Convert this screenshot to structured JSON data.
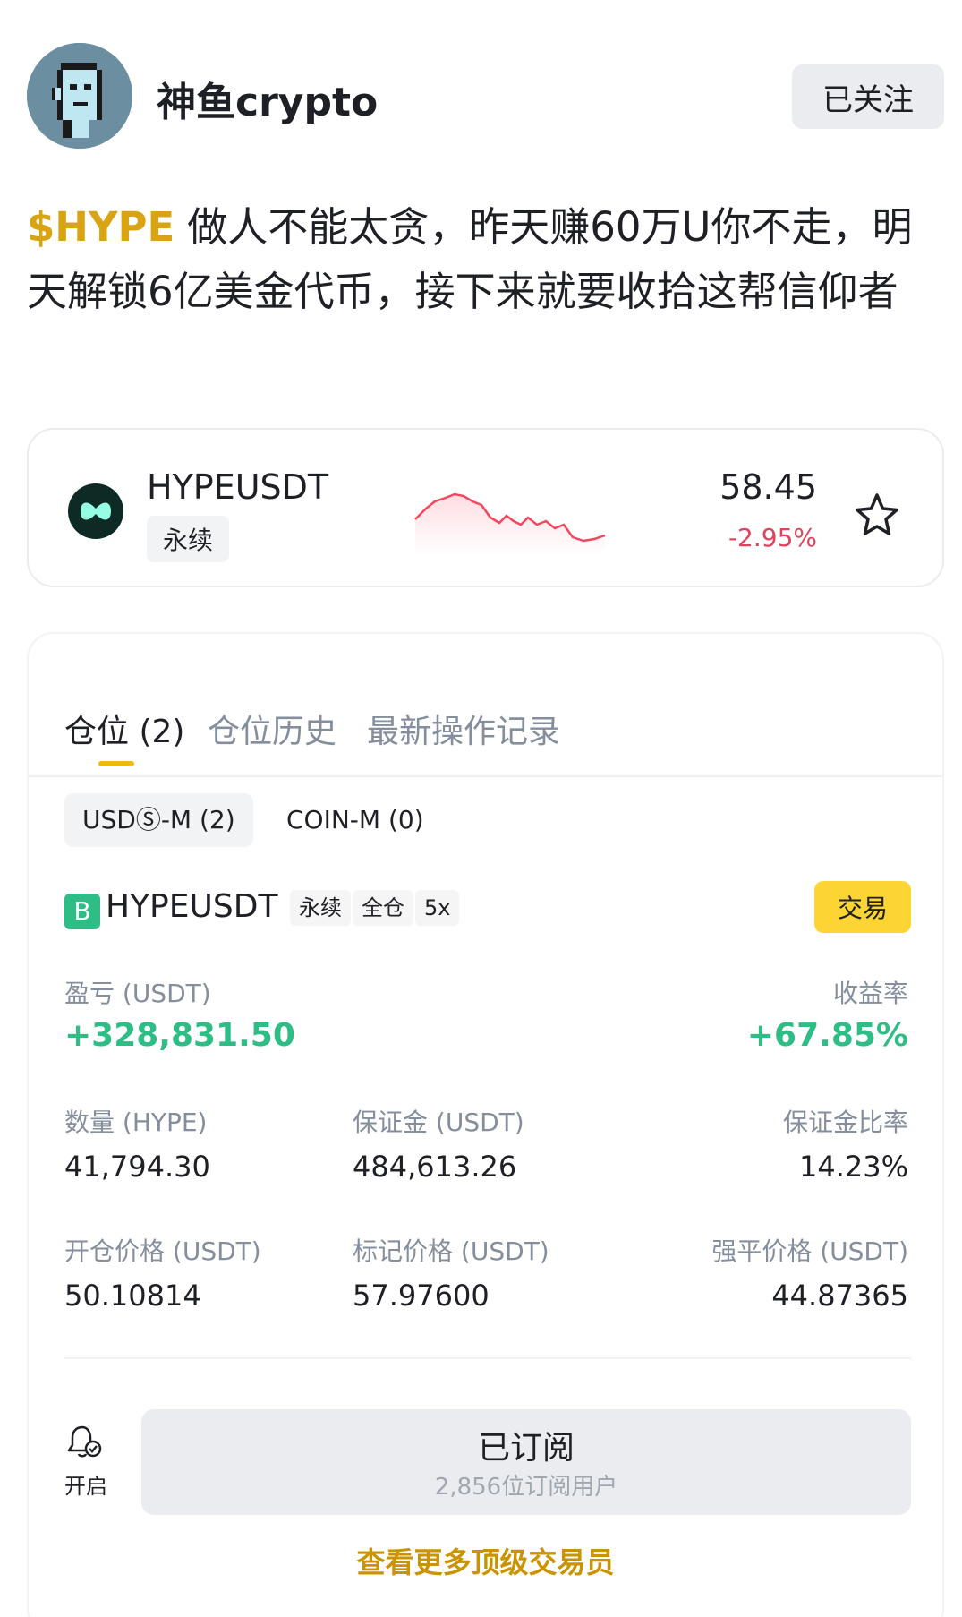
{
  "header": {
    "author_name": "神鱼crypto",
    "follow_label": "已关注"
  },
  "post": {
    "ticker": "$HYPE",
    "text": "做人不能太贪，昨天赚60万U你不走，明天解锁6亿美金代币，接下来就要收拾这帮信仰者"
  },
  "price_card": {
    "symbol": "HYPEUSDT",
    "type_tag": "永续",
    "price": "58.45",
    "change": "-2.95%"
  },
  "positions": {
    "tabs": [
      {
        "label": "仓位 (2)",
        "active": true
      },
      {
        "label": "仓位历史",
        "active": false
      },
      {
        "label": "最新操作记录",
        "active": false
      }
    ],
    "segments": [
      {
        "label": "USDⓈ-M (2)",
        "active": true
      },
      {
        "label": "COIN-M (0)",
        "active": false
      }
    ],
    "position": {
      "badge": "B",
      "symbol": "HYPEUSDT",
      "tags": [
        "永续",
        "全仓",
        "5x"
      ],
      "trade_label": "交易",
      "pnl_label": "盈亏 (USDT)",
      "pnl_value": "+328,831.50",
      "roe_label": "收益率",
      "roe_value": "+67.85%",
      "qty_label": "数量 (HYPE)",
      "qty_value": "41,794.30",
      "margin_label": "保证金 (USDT)",
      "margin_value": "484,613.26",
      "margin_ratio_label": "保证金比率",
      "margin_ratio_value": "14.23%",
      "entry_label": "开仓价格 (USDT)",
      "entry_value": "50.10814",
      "mark_label": "标记价格 (USDT)",
      "mark_value": "57.97600",
      "liq_label": "强平价格 (USDT)",
      "liq_value": "44.87365"
    },
    "subscribe": {
      "bell_label": "开启",
      "title": "已订阅",
      "count": "2,856位订阅用户"
    },
    "more_link": "查看更多顶级交易员"
  },
  "colors": {
    "accent": "#f0b90b",
    "ticker": "#d9a414",
    "profit": "#2ebd85",
    "loss": "#e0435c"
  }
}
